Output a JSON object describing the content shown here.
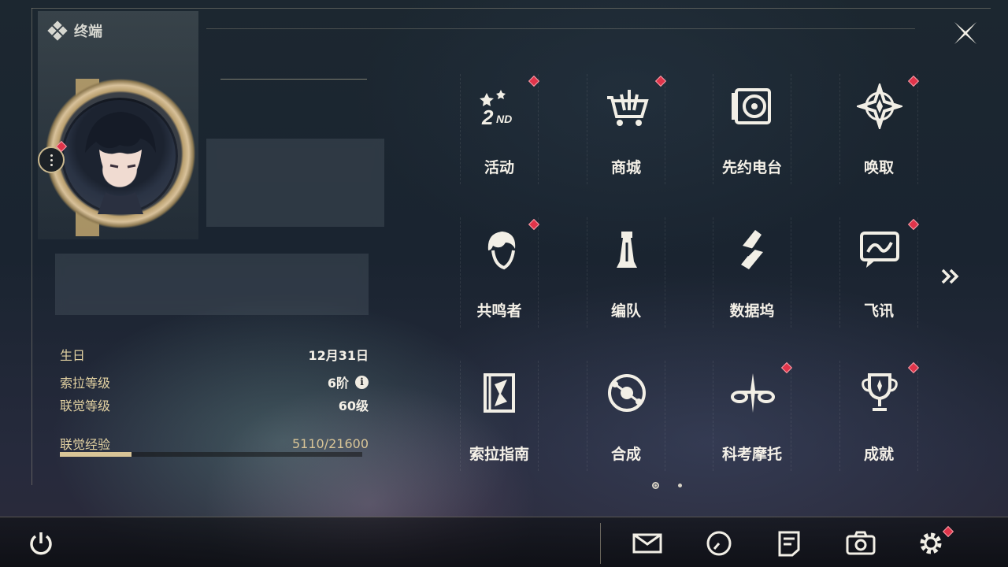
{
  "header": {
    "title": "终端",
    "close_icon": "close-x-icon"
  },
  "profile": {
    "more_icon": "more-vertical-icon",
    "rows": [
      {
        "label": "生日",
        "value": "12月31日"
      },
      {
        "label": "索拉等级",
        "value": "6阶",
        "info_icon": "i"
      },
      {
        "label": "联觉等级",
        "value": "60级"
      },
      {
        "label": "联觉经验",
        "value": "5110/21600",
        "progress": 0.2366
      }
    ]
  },
  "menu": [
    {
      "label": "活动",
      "icon": "2nd-anniversary-icon",
      "badge": true
    },
    {
      "label": "商城",
      "icon": "shop-cart-icon",
      "badge": true
    },
    {
      "label": "先约电台",
      "icon": "radio-record-icon",
      "badge": false
    },
    {
      "label": "唤取",
      "icon": "convene-star-icon",
      "badge": true
    },
    {
      "label": "共鸣者",
      "icon": "resonator-portrait-icon",
      "badge": true
    },
    {
      "label": "编队",
      "icon": "team-chess-icon",
      "badge": false
    },
    {
      "label": "数据坞",
      "icon": "data-dock-icon",
      "badge": false
    },
    {
      "label": "飞讯",
      "icon": "chat-message-icon",
      "badge": true
    },
    {
      "label": "索拉指南",
      "icon": "guide-book-icon",
      "badge": false
    },
    {
      "label": "合成",
      "icon": "synthesis-orbit-icon",
      "badge": false
    },
    {
      "label": "科考摩托",
      "icon": "motorbike-icon",
      "badge": true
    },
    {
      "label": "成就",
      "icon": "trophy-icon",
      "badge": true
    }
  ],
  "pager": {
    "pages": 2,
    "current": 1
  },
  "bottom": {
    "icons": [
      "power-icon",
      "mail-icon",
      "clock-icon",
      "notes-icon",
      "camera-icon",
      "settings-gear-icon"
    ],
    "settings_badge": true
  },
  "colors": {
    "accent": "#d9c597",
    "badge": "#e0344a",
    "label_gold": "#e3d2a2"
  }
}
